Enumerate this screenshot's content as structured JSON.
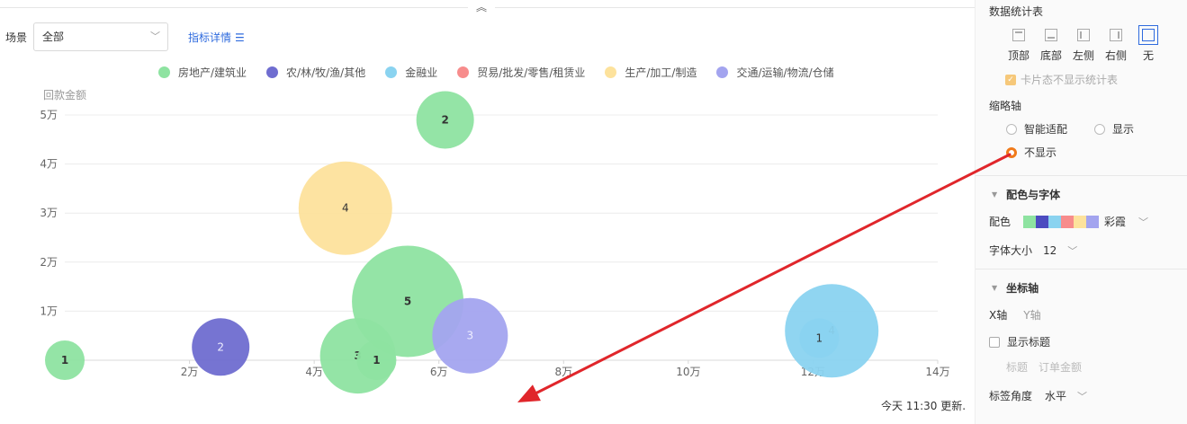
{
  "header": {
    "scene_label": "场景",
    "scene_value": "全部",
    "detail_link": "指标详情"
  },
  "legend": [
    {
      "name": "房地产/建筑业",
      "color": "#8ee3a1"
    },
    {
      "name": "农/林/牧/渔/其他",
      "color": "#6f6dd0"
    },
    {
      "name": "金融业",
      "color": "#8ad3f0"
    },
    {
      "name": "贸易/批发/零售/租赁业",
      "color": "#f78c8c"
    },
    {
      "name": "生产/加工/制造",
      "color": "#fde29c"
    },
    {
      "name": "交通/运输/物流/仓储",
      "color": "#a3a4ef"
    }
  ],
  "chart_data": {
    "type": "scatter",
    "variant": "bubble",
    "ylabel": "回款金额",
    "xlabel": "",
    "xlim": [
      0,
      140000
    ],
    "ylim": [
      0,
      50000
    ],
    "x_ticks": [
      "2万",
      "4万",
      "6万",
      "8万",
      "10万",
      "12万",
      "14万"
    ],
    "y_ticks": [
      "1万",
      "2万",
      "3万",
      "4万",
      "5万"
    ],
    "grid": true,
    "legend_position": "top",
    "bubbles": [
      {
        "series": "房地产/建筑业",
        "x": 0,
        "y": 0,
        "size": 1
      },
      {
        "series": "农/林/牧/渔/其他",
        "x": 25000,
        "y": 2700,
        "size": 2
      },
      {
        "series": "房地产/建筑业",
        "x": 47000,
        "y": 900,
        "size": 3
      },
      {
        "series": "房地产/建筑业",
        "x": 50000,
        "y": 0,
        "size": 1
      },
      {
        "series": "生产/加工/制造",
        "x": 45000,
        "y": 31000,
        "size": 4
      },
      {
        "series": "房地产/建筑业",
        "x": 61000,
        "y": 49000,
        "size": 2
      },
      {
        "series": "房地产/建筑业",
        "x": 55000,
        "y": 12000,
        "size": 5
      },
      {
        "series": "交通/运输/物流/仓储",
        "x": 65000,
        "y": 5000,
        "size": 3
      },
      {
        "series": "金融业",
        "x": 121000,
        "y": 4500,
        "size": 1
      },
      {
        "series": "金融业",
        "x": 123000,
        "y": 6000,
        "size": 4
      }
    ]
  },
  "update_text": "今天 11:30 更新.",
  "panel": {
    "stats_title": "数据统计表",
    "positions": [
      {
        "label": "顶部",
        "active": false
      },
      {
        "label": "底部",
        "active": false
      },
      {
        "label": "左侧",
        "active": false
      },
      {
        "label": "右侧",
        "active": false
      },
      {
        "label": "无",
        "active": true
      }
    ],
    "card_check_label": "卡片态不显示统计表",
    "thumb_axis_label": "缩略轴",
    "thumb_options": [
      "智能适配",
      "显示",
      "不显示"
    ],
    "thumb_selected": "不显示",
    "color_font_title": "配色与字体",
    "palette_label": "配色",
    "palette_name": "彩霞",
    "palette_colors": [
      "#8ee3a1",
      "#4c4cc0",
      "#8ad3f0",
      "#f78c8c",
      "#fde29c",
      "#a3a4ef"
    ],
    "font_size_label": "字体大小",
    "font_size_value": "12",
    "axis_title": "坐标轴",
    "x_axis_tab": "X轴",
    "y_axis_tab": "Y轴",
    "show_title_label": "显示标题",
    "title_label": "标题",
    "title_value": "订单金额",
    "angle_label": "标签角度",
    "angle_value": "水平"
  },
  "annotation_color": "#e0262b"
}
